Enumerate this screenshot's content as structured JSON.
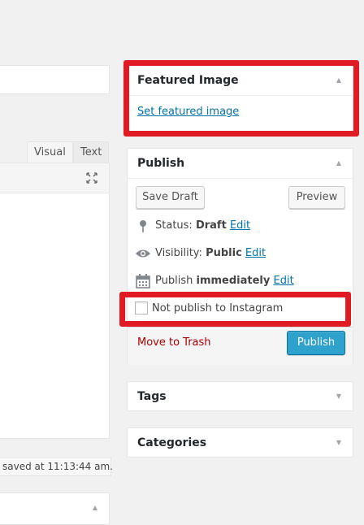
{
  "editor": {
    "tabs": [
      {
        "label": "Visual"
      },
      {
        "label": "Text"
      }
    ],
    "status_text": "saved at 11:13:44 am."
  },
  "featured_image": {
    "title": "Featured Image",
    "set_link": "Set featured image"
  },
  "publish": {
    "title": "Publish",
    "save_draft": "Save Draft",
    "preview": "Preview",
    "status_label": "Status:",
    "status_value": "Draft",
    "visibility_label": "Visibility:",
    "visibility_value": "Public",
    "publish_label": "Publish",
    "publish_value": "immediately",
    "edit_link": "Edit",
    "instagram_checkbox_label": "Not publish to Instagram",
    "move_to_trash": "Move to Trash",
    "publish_button": "Publish"
  },
  "tags": {
    "title": "Tags"
  },
  "categories": {
    "title": "Categories"
  },
  "colors": {
    "accent": "#0073aa",
    "primary_button": "#2ea2cc",
    "trash": "#a00",
    "highlight": "#e01b24"
  }
}
